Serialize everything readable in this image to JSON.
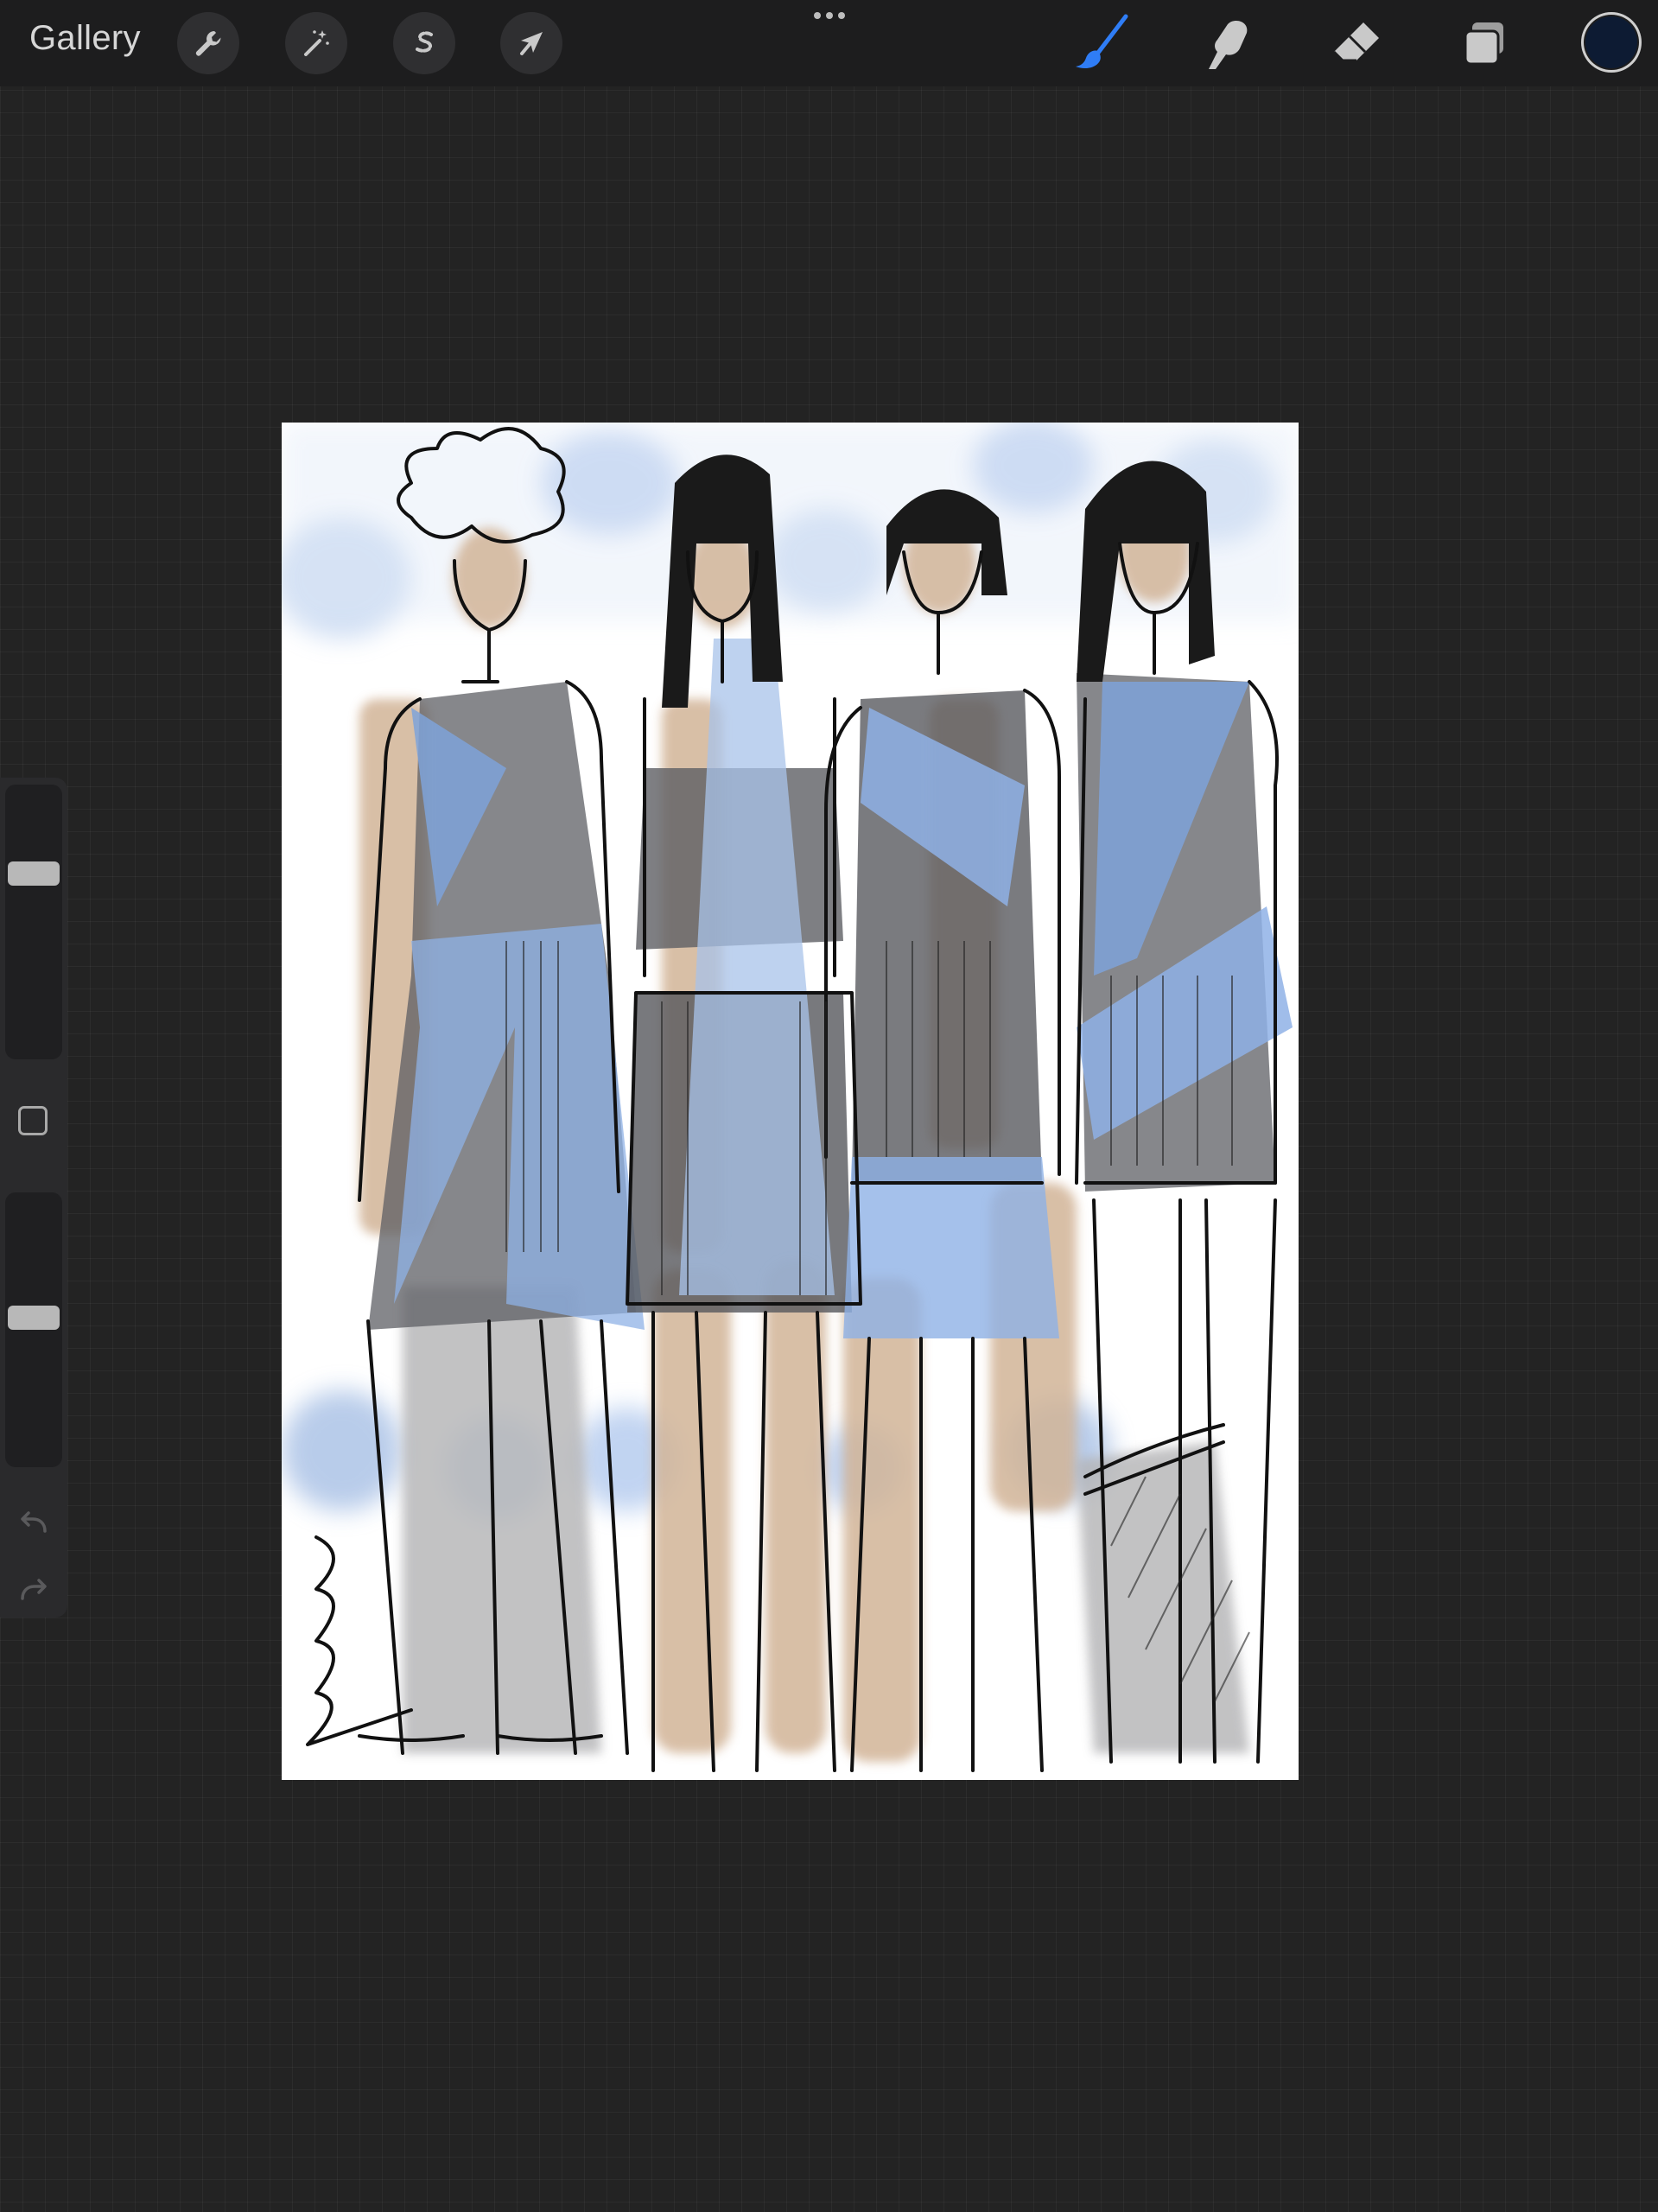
{
  "toolbar": {
    "gallery_label": "Gallery",
    "left_tools": [
      {
        "name": "actions",
        "icon": "wrench-icon"
      },
      {
        "name": "adjustments",
        "icon": "magic-wand-icon"
      },
      {
        "name": "selection",
        "icon": "selection-s-icon"
      },
      {
        "name": "transform",
        "icon": "arrow-cursor-icon"
      }
    ],
    "more_icon": "more-dots-icon",
    "right_tools": [
      {
        "name": "brush",
        "icon": "brush-icon",
        "active": true
      },
      {
        "name": "smudge",
        "icon": "smudge-icon",
        "active": false
      },
      {
        "name": "eraser",
        "icon": "eraser-icon",
        "active": false
      },
      {
        "name": "layers",
        "icon": "layers-icon",
        "active": false
      }
    ],
    "current_color": "#0d1b33",
    "active_tool_color": "#2f7df6"
  },
  "sidebar": {
    "brush_size_level": 0.7,
    "opacity_level": 0.55,
    "modify_icon": "square-icon",
    "undo_icon": "undo-icon",
    "redo_icon": "redo-icon"
  },
  "canvas": {
    "content": "fashion-sketch-illustration",
    "palette": {
      "paper": "#ffffff",
      "blue_wash": "#a8c3ea",
      "deep_blue": "#7fa3d9",
      "skin": "#d2b497",
      "grey": "#8f9094",
      "ink": "#111111"
    }
  }
}
